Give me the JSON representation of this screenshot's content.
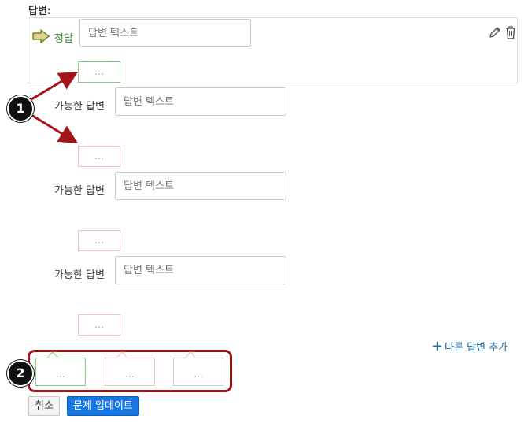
{
  "heading": "답변:",
  "correct_answer": {
    "label": "정답",
    "placeholder": "답변 텍스트",
    "feedback_dots": "..."
  },
  "possible_answers": [
    {
      "label": "가능한 답변",
      "placeholder": "답변 텍스트",
      "feedback_dots": "..."
    },
    {
      "label": "가능한 답변",
      "placeholder": "답변 텍스트",
      "feedback_dots": "..."
    },
    {
      "label": "가능한 답변",
      "placeholder": "답변 텍스트",
      "feedback_dots": "..."
    }
  ],
  "add_answer": {
    "icon": "+",
    "label": "다른 답변 추가"
  },
  "general_feedback": [
    "...",
    "...",
    "..."
  ],
  "callouts": [
    "1",
    "2"
  ],
  "buttons": {
    "cancel": "취소",
    "update": "문제 업데이트"
  },
  "colors": {
    "correct_green": "#2f8a2f",
    "feedback_green_border": "#8cc98c",
    "feedback_pink_border": "#f0c0c0",
    "feedback_blue_border": "#c6cdd8",
    "callout_red": "#a3141b",
    "primary_blue": "#1677e5",
    "link_blue": "#1d6fa8"
  }
}
